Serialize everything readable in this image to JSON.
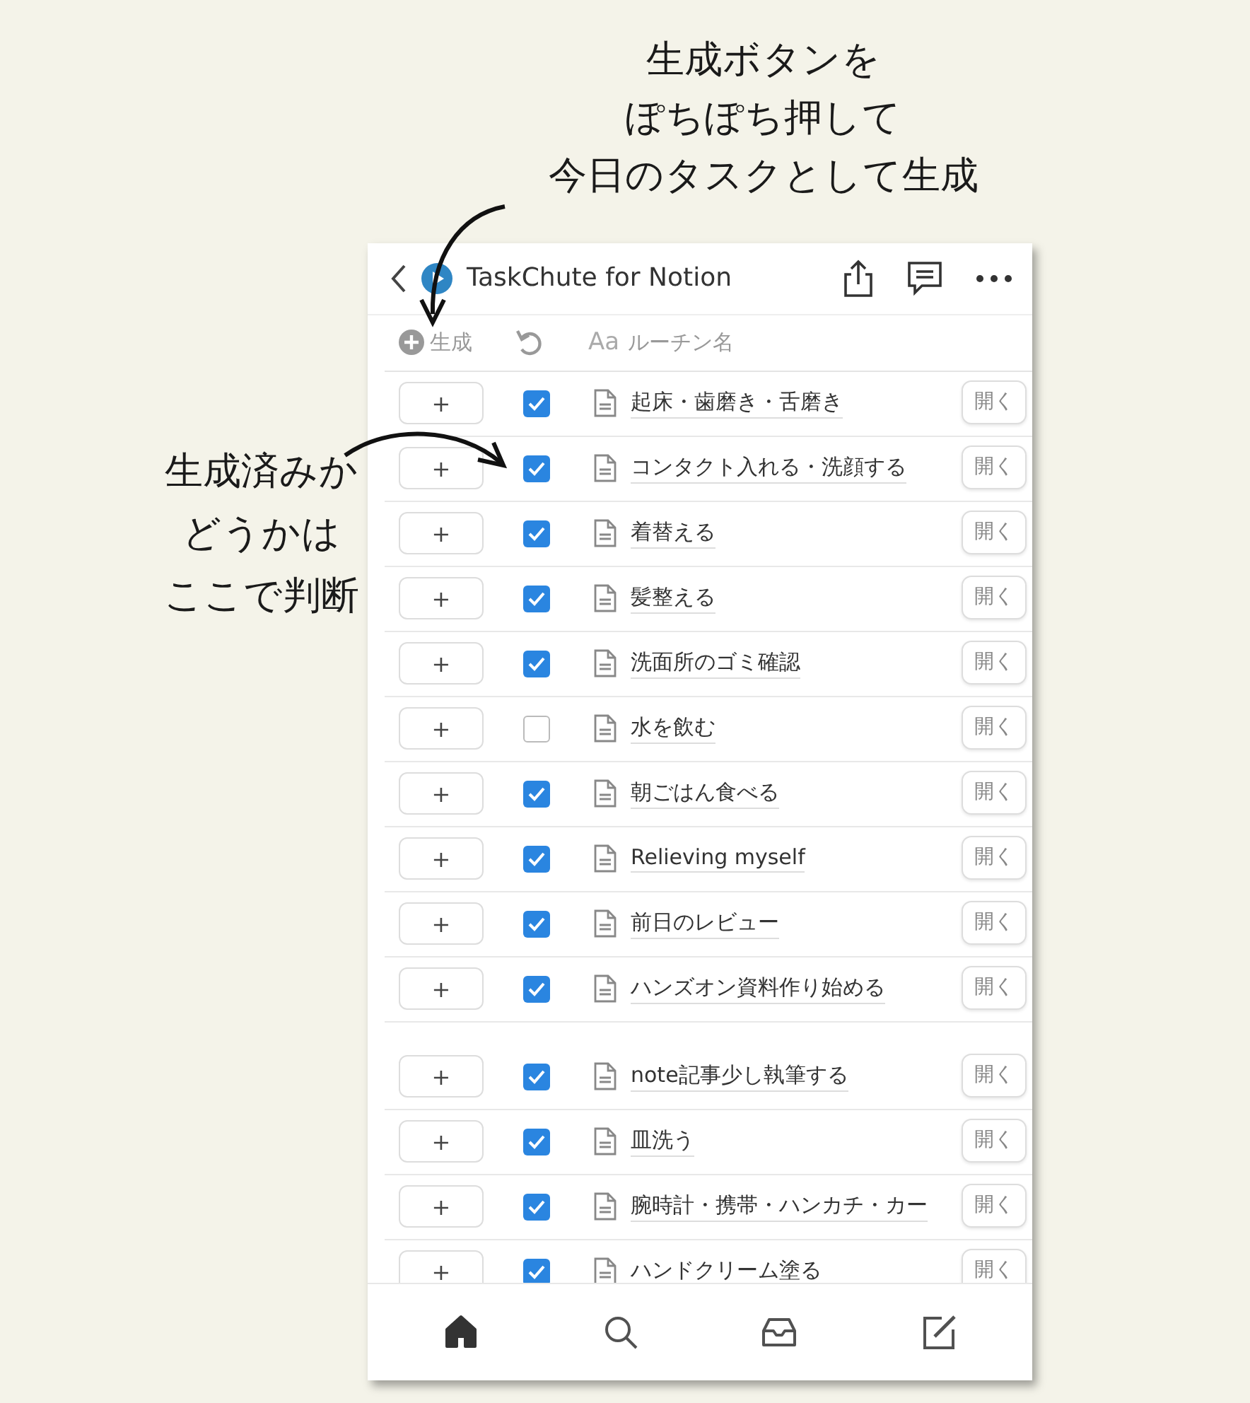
{
  "annotations": [
    {
      "kind": "top",
      "lines": [
        "生成ボタンを",
        "ぽちぽち押して",
        "今日のタスクとして生成"
      ]
    },
    {
      "kind": "left",
      "lines": [
        "生成済みか",
        "どうかは",
        "ここで判断"
      ]
    }
  ],
  "header": {
    "title": "TaskChute for Notion"
  },
  "columns": [
    {
      "kind": "generate",
      "label": "生成"
    },
    {
      "kind": "done"
    },
    {
      "kind": "title",
      "prefix": "Aa",
      "label": "ルーチン名"
    }
  ],
  "groups": [
    {
      "rows": [
        {
          "add": "+",
          "checked": true,
          "title": "起床・歯磨き・舌磨き",
          "open": "開く"
        },
        {
          "add": "+",
          "checked": true,
          "title": "コンタクト入れる・洗顔する",
          "open": "開く"
        },
        {
          "add": "+",
          "checked": true,
          "title": "着替える",
          "open": "開く"
        },
        {
          "add": "+",
          "checked": true,
          "title": "髪整える",
          "open": "開く"
        },
        {
          "add": "+",
          "checked": true,
          "title": "洗面所のゴミ確認",
          "open": "開く"
        },
        {
          "add": "+",
          "checked": false,
          "title": "水を飲む",
          "open": "開く"
        },
        {
          "add": "+",
          "checked": true,
          "title": "朝ごはん食べる",
          "open": "開く"
        },
        {
          "add": "+",
          "checked": true,
          "title": "Relieving myself",
          "open": "開く"
        },
        {
          "add": "+",
          "checked": true,
          "title": "前日のレビュー",
          "open": "開く"
        },
        {
          "add": "+",
          "checked": true,
          "title": "ハンズオン資料作り始める",
          "open": "開く"
        }
      ]
    },
    {
      "rows": [
        {
          "add": "+",
          "checked": true,
          "title": "note記事少し執筆する",
          "open": "開く"
        },
        {
          "add": "+",
          "checked": true,
          "title": "皿洗う",
          "open": "開く"
        },
        {
          "add": "+",
          "checked": true,
          "title": "腕時計・携帯・ハンカチ・カー",
          "open": "開く"
        },
        {
          "add": "+",
          "checked": true,
          "title": "ハンドクリーム塗る",
          "open": "開く"
        }
      ]
    }
  ],
  "nav": [
    {
      "kind": "home",
      "selected": true
    },
    {
      "kind": "search",
      "selected": false
    },
    {
      "kind": "inbox",
      "selected": false
    },
    {
      "kind": "compose",
      "selected": false
    }
  ]
}
